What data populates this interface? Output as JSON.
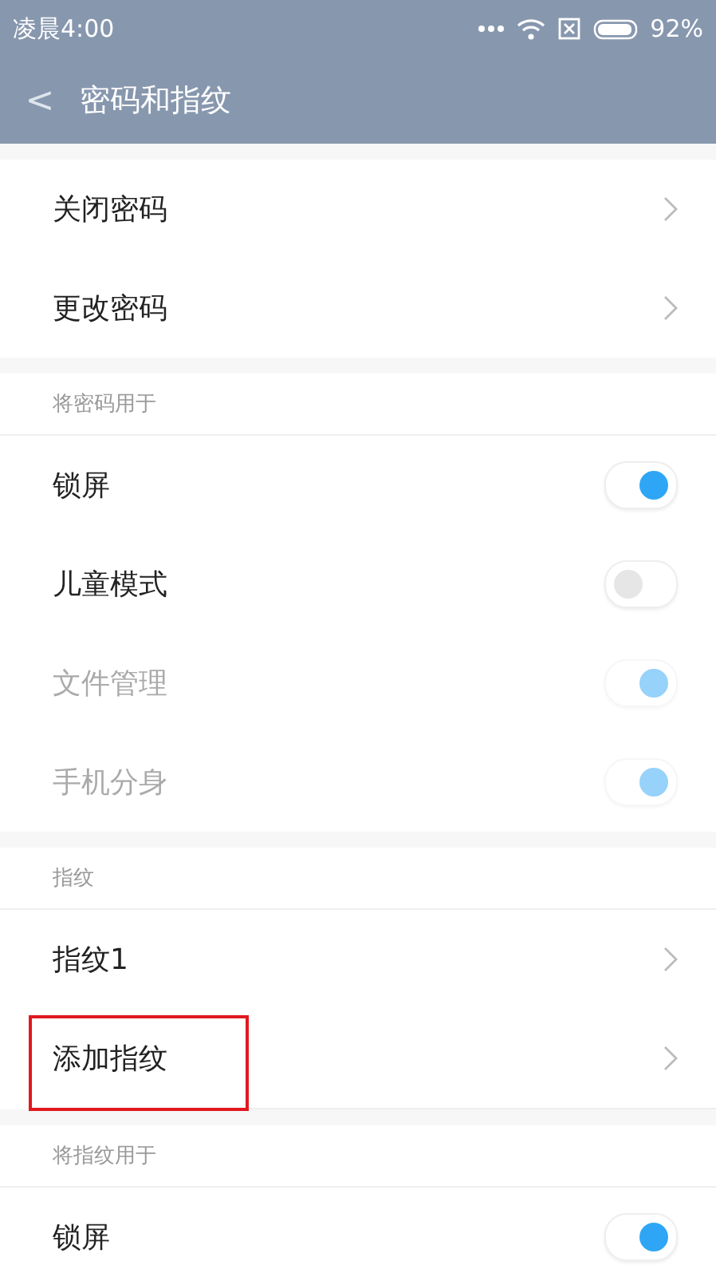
{
  "status_bar": {
    "time": "凌晨4:00",
    "battery": "92%"
  },
  "header": {
    "back": "<",
    "title": "密码和指纹"
  },
  "sections": [
    {
      "items": [
        {
          "kind": "link",
          "label": "关闭密码",
          "disabled": false,
          "highlighted": false
        },
        {
          "kind": "link",
          "label": "更改密码",
          "disabled": false,
          "highlighted": false
        }
      ]
    },
    {
      "heading": "将密码用于",
      "items": [
        {
          "kind": "toggle",
          "label": "锁屏",
          "on": true,
          "disabled": false,
          "highlighted": false
        },
        {
          "kind": "toggle",
          "label": "儿童模式",
          "on": false,
          "disabled": false,
          "highlighted": false
        },
        {
          "kind": "toggle",
          "label": "文件管理",
          "on": true,
          "disabled": true,
          "highlighted": false
        },
        {
          "kind": "toggle",
          "label": "手机分身",
          "on": true,
          "disabled": true,
          "highlighted": false
        }
      ]
    },
    {
      "heading": "指纹",
      "items": [
        {
          "kind": "link",
          "label": "指纹1",
          "disabled": false,
          "highlighted": false
        },
        {
          "kind": "link",
          "label": "添加指纹",
          "disabled": false,
          "highlighted": true
        }
      ]
    },
    {
      "heading": "将指纹用于",
      "items": [
        {
          "kind": "toggle",
          "label": "锁屏",
          "on": true,
          "disabled": false,
          "highlighted": false
        }
      ]
    }
  ]
}
